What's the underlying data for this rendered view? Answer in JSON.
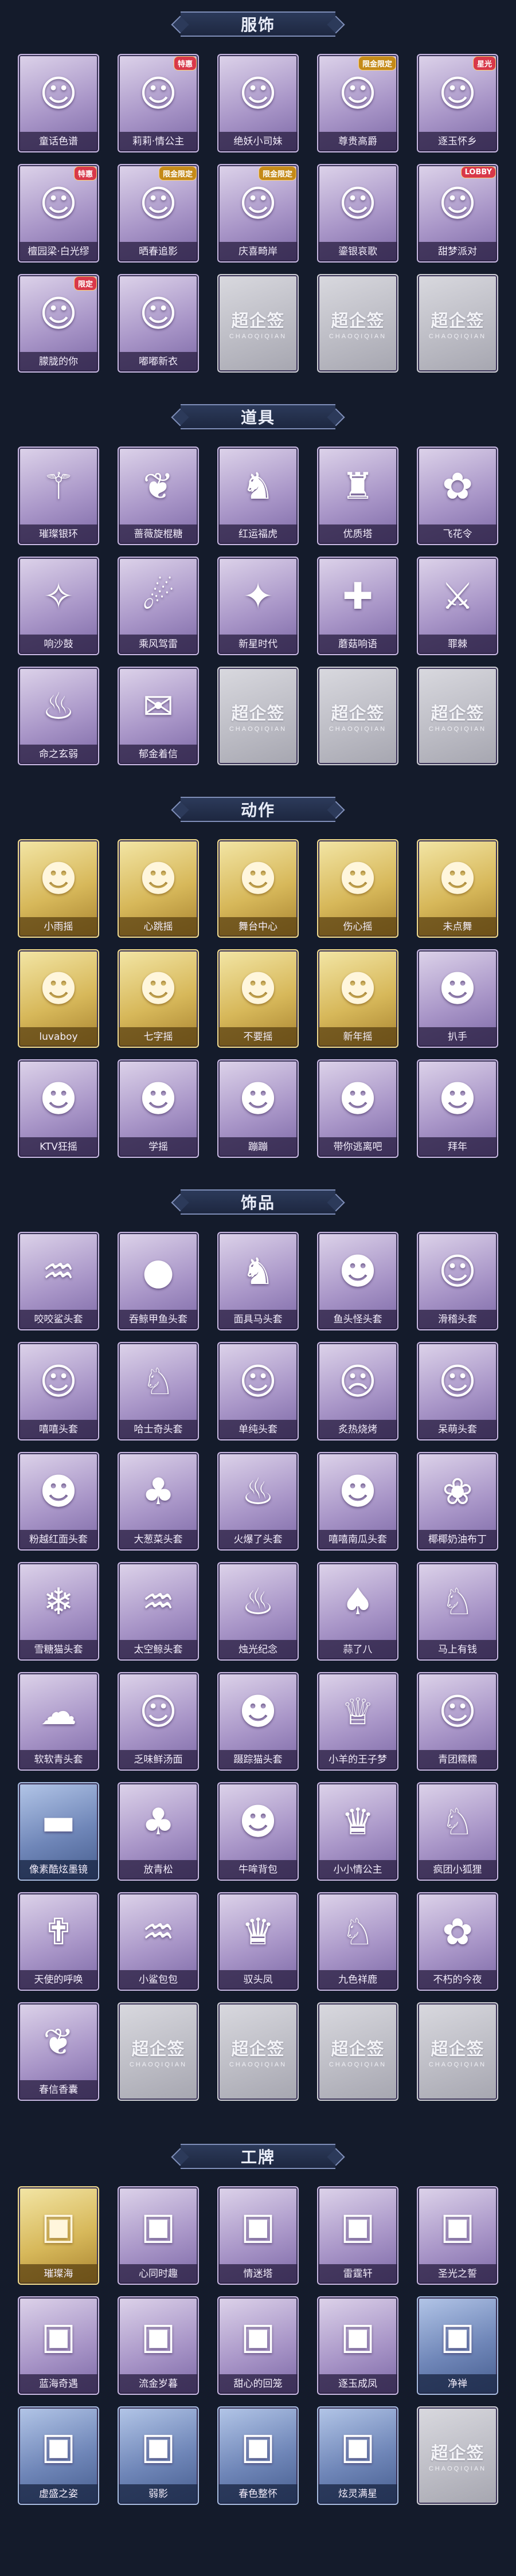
{
  "sections": [
    {
      "id": "costume",
      "title": "服饰",
      "items": [
        {
          "label": "童话色谱",
          "glyph": "☺",
          "tone": "purple"
        },
        {
          "label": "莉莉·情公主",
          "glyph": "☺",
          "tone": "purple",
          "badge": "特惠"
        },
        {
          "label": "绝妖小司妹",
          "glyph": "☺",
          "tone": "purple"
        },
        {
          "label": "尊贵高爵",
          "glyph": "☺",
          "tone": "purple",
          "badge": "限金限定"
        },
        {
          "label": "逐玉怀乡",
          "glyph": "☺",
          "tone": "purple",
          "badge": "星光"
        },
        {
          "label": "檀园梁·白光缪",
          "glyph": "☺",
          "tone": "purple",
          "badge": "特惠"
        },
        {
          "label": "晒春追影",
          "glyph": "☺",
          "tone": "purple",
          "badge": "限金限定"
        },
        {
          "label": "庆喜畸岸",
          "glyph": "☺",
          "tone": "purple",
          "badge": "限金限定"
        },
        {
          "label": "鎏银哀歌",
          "glyph": "☺",
          "tone": "purple"
        },
        {
          "label": "甜梦派对",
          "glyph": "☺",
          "tone": "purple",
          "badge": "LOBBY"
        },
        {
          "label": "朦胧的你",
          "glyph": "☺",
          "tone": "purple",
          "badge": "限定"
        },
        {
          "label": "嘟嘟新衣",
          "glyph": "☺",
          "tone": "purple"
        },
        {
          "empty": true
        },
        {
          "empty": true
        },
        {
          "empty": true
        }
      ]
    },
    {
      "id": "props",
      "title": "道具",
      "items": [
        {
          "label": "璀璨银环",
          "glyph": "⚚",
          "tone": "purple"
        },
        {
          "label": "蔷薇旋棍糖",
          "glyph": "❦",
          "tone": "purple"
        },
        {
          "label": "红运福虎",
          "glyph": "♞",
          "tone": "purple"
        },
        {
          "label": "优质塔",
          "glyph": "♜",
          "tone": "purple"
        },
        {
          "label": "飞花令",
          "glyph": "✿",
          "tone": "purple"
        },
        {
          "label": "响沙鼓",
          "glyph": "✧",
          "tone": "purple"
        },
        {
          "label": "乘风驾雷",
          "glyph": "☄",
          "tone": "purple"
        },
        {
          "label": "新星时代",
          "glyph": "✦",
          "tone": "purple"
        },
        {
          "label": "蘑菇响语",
          "glyph": "✚",
          "tone": "purple"
        },
        {
          "label": "罪棘",
          "glyph": "⚔",
          "tone": "purple"
        },
        {
          "label": "命之玄弱",
          "glyph": "♨",
          "tone": "purple"
        },
        {
          "label": "郁金着信",
          "glyph": "✉",
          "tone": "purple"
        },
        {
          "empty": true
        },
        {
          "empty": true
        },
        {
          "empty": true
        }
      ]
    },
    {
      "id": "actions",
      "title": "动作",
      "items": [
        {
          "label": "小雨摇",
          "glyph": "☻",
          "tone": "gold"
        },
        {
          "label": "心跳摇",
          "glyph": "☻",
          "tone": "gold"
        },
        {
          "label": "舞台中心",
          "glyph": "☻",
          "tone": "gold"
        },
        {
          "label": "伤心摇",
          "glyph": "☻",
          "tone": "gold"
        },
        {
          "label": "未点舞",
          "glyph": "☻",
          "tone": "gold"
        },
        {
          "label": "luvaboy",
          "glyph": "☻",
          "tone": "gold"
        },
        {
          "label": "七字摇",
          "glyph": "☻",
          "tone": "gold"
        },
        {
          "label": "不要摇",
          "glyph": "☻",
          "tone": "gold"
        },
        {
          "label": "新年摇",
          "glyph": "☻",
          "tone": "gold"
        },
        {
          "label": "扒手",
          "glyph": "☻",
          "tone": "purple"
        },
        {
          "label": "KTV狂摇",
          "glyph": "☻",
          "tone": "purple"
        },
        {
          "label": "学摇",
          "glyph": "☻",
          "tone": "purple"
        },
        {
          "label": "蹦蹦",
          "glyph": "☻",
          "tone": "purple"
        },
        {
          "label": "带你逃离吧",
          "glyph": "☻",
          "tone": "purple"
        },
        {
          "label": "拜年",
          "glyph": "☻",
          "tone": "purple"
        }
      ]
    },
    {
      "id": "accessories",
      "title": "饰品",
      "items": [
        {
          "label": "咬咬鲨头套",
          "glyph": "♒",
          "tone": "purple"
        },
        {
          "label": "吞鲸甲鱼头套",
          "glyph": "●",
          "tone": "purple"
        },
        {
          "label": "面具马头套",
          "glyph": "♞",
          "tone": "purple"
        },
        {
          "label": "鱼头怪头套",
          "glyph": "☻",
          "tone": "purple"
        },
        {
          "label": "滑稽头套",
          "glyph": "☺",
          "tone": "purple"
        },
        {
          "label": "嘻嘻头套",
          "glyph": "☺",
          "tone": "purple"
        },
        {
          "label": "哈士奇头套",
          "glyph": "♘",
          "tone": "purple"
        },
        {
          "label": "单纯头套",
          "glyph": "☺",
          "tone": "purple"
        },
        {
          "label": "炙热烧烤",
          "glyph": "☹",
          "tone": "purple"
        },
        {
          "label": "呆萌头套",
          "glyph": "☺",
          "tone": "purple"
        },
        {
          "label": "粉越红面头套",
          "glyph": "☻",
          "tone": "purple"
        },
        {
          "label": "大葱菜头套",
          "glyph": "♣",
          "tone": "purple"
        },
        {
          "label": "火爆了头套",
          "glyph": "♨",
          "tone": "purple"
        },
        {
          "label": "嘻嘻南瓜头套",
          "glyph": "☻",
          "tone": "purple"
        },
        {
          "label": "椰椰奶油布丁",
          "glyph": "❀",
          "tone": "purple"
        },
        {
          "label": "雪糖猫头套",
          "glyph": "❄",
          "tone": "purple"
        },
        {
          "label": "太空鲸头套",
          "glyph": "♒",
          "tone": "purple"
        },
        {
          "label": "烛光纪念",
          "glyph": "♨",
          "tone": "purple"
        },
        {
          "label": "蒜了八",
          "glyph": "♠",
          "tone": "purple"
        },
        {
          "label": "马上有钱",
          "glyph": "♘",
          "tone": "purple"
        },
        {
          "label": "软软青头套",
          "glyph": "☁",
          "tone": "purple"
        },
        {
          "label": "乏味鲜汤面",
          "glyph": "☺",
          "tone": "purple"
        },
        {
          "label": "蹑踪猫头套",
          "glyph": "☻",
          "tone": "purple"
        },
        {
          "label": "小羊的王子梦",
          "glyph": "♕",
          "tone": "purple"
        },
        {
          "label": "青团糯糯",
          "glyph": "☺",
          "tone": "purple"
        },
        {
          "label": "像素酷炫墨镜",
          "glyph": "▬",
          "tone": "blue"
        },
        {
          "label": "放青松",
          "glyph": "♣",
          "tone": "purple"
        },
        {
          "label": "牛哞背包",
          "glyph": "☻",
          "tone": "purple"
        },
        {
          "label": "小小情公主",
          "glyph": "♛",
          "tone": "purple"
        },
        {
          "label": "疯团小狐狸",
          "glyph": "♘",
          "tone": "purple"
        },
        {
          "label": "天使的呼唤",
          "glyph": "✟",
          "tone": "purple"
        },
        {
          "label": "小鲨包包",
          "glyph": "♒",
          "tone": "purple"
        },
        {
          "label": "驭头凤",
          "glyph": "♛",
          "tone": "purple"
        },
        {
          "label": "九色祥鹿",
          "glyph": "♘",
          "tone": "purple"
        },
        {
          "label": "不朽的今夜",
          "glyph": "✿",
          "tone": "purple"
        },
        {
          "label": "春信香囊",
          "glyph": "❦",
          "tone": "purple"
        },
        {
          "empty": true
        },
        {
          "empty": true
        },
        {
          "empty": true
        },
        {
          "empty": true
        }
      ]
    },
    {
      "id": "badges",
      "title": "工牌",
      "items": [
        {
          "label": "璀璨海",
          "glyph": "▣",
          "tone": "gold"
        },
        {
          "label": "心同时趣",
          "glyph": "▣",
          "tone": "purple"
        },
        {
          "label": "情迷塔",
          "glyph": "▣",
          "tone": "purple"
        },
        {
          "label": "雷霆轩",
          "glyph": "▣",
          "tone": "purple"
        },
        {
          "label": "圣光之誓",
          "glyph": "▣",
          "tone": "purple"
        },
        {
          "label": "蓝海奇遇",
          "glyph": "▣",
          "tone": "purple"
        },
        {
          "label": "流金岁暮",
          "glyph": "▣",
          "tone": "purple"
        },
        {
          "label": "甜心的回笼",
          "glyph": "▣",
          "tone": "purple"
        },
        {
          "label": "逐玉成凤",
          "glyph": "▣",
          "tone": "purple"
        },
        {
          "label": "净禅",
          "glyph": "▣",
          "tone": "blue"
        },
        {
          "label": "虚盛之姿",
          "glyph": "▣",
          "tone": "blue"
        },
        {
          "label": "弱影",
          "glyph": "▣",
          "tone": "blue"
        },
        {
          "label": "春色整怀",
          "glyph": "▣",
          "tone": "blue"
        },
        {
          "label": "炫灵满星",
          "glyph": "▣",
          "tone": "blue"
        },
        {
          "empty": true
        }
      ]
    }
  ],
  "placeholder": {
    "logo": "超企签",
    "sub": "CHAOQIQIAN"
  }
}
